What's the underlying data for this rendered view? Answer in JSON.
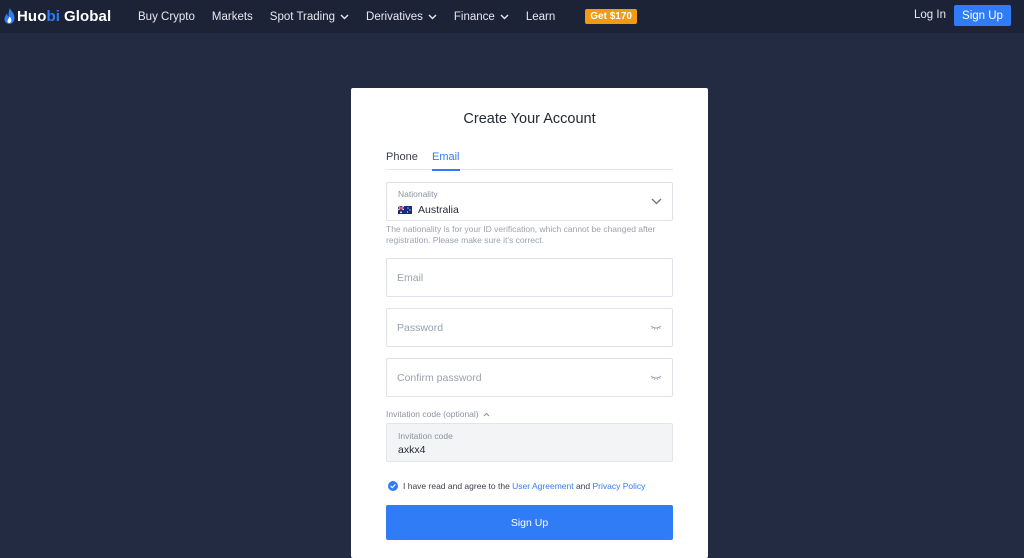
{
  "brand": {
    "name_part1": "Huo",
    "name_accent": "bi",
    "name_part2": "Global"
  },
  "nav": {
    "items": [
      {
        "label": "Buy Crypto",
        "dropdown": false
      },
      {
        "label": "Markets",
        "dropdown": false
      },
      {
        "label": "Spot Trading",
        "dropdown": true
      },
      {
        "label": "Derivatives",
        "dropdown": true
      },
      {
        "label": "Finance",
        "dropdown": true
      },
      {
        "label": "Learn",
        "dropdown": false
      }
    ],
    "promo": "Get $170",
    "login": "Log In",
    "signup": "Sign Up"
  },
  "form": {
    "title": "Create Your Account",
    "tabs": {
      "phone": "Phone",
      "email": "Email",
      "active": "Email"
    },
    "nationality": {
      "label": "Nationality",
      "value": "Australia",
      "hint": "The nationality is for your ID verification, which cannot be changed after registration. Please make sure it's correct."
    },
    "email_placeholder": "Email",
    "password_placeholder": "Password",
    "confirm_placeholder": "Confirm password",
    "invitation_toggle": "Invitation code (optional)",
    "invitation_label": "Invitation code",
    "invitation_value": "axkx4",
    "agree": {
      "prefix": "I have read and agree to the ",
      "user_agreement": "User Agreement",
      "and": " and ",
      "privacy_policy": "Privacy Policy",
      "checked": true
    },
    "submit": "Sign Up"
  },
  "colors": {
    "accent": "#2f7cf6",
    "promo": "#f29a13",
    "page_bg": "#232b42",
    "nav_bg": "#1c2337"
  },
  "icons": [
    "huobi-flame-icon",
    "chevron-down-icon",
    "australia-flag-icon",
    "eye-closed-icon",
    "chevron-up-icon",
    "checkbox-checked-icon"
  ]
}
